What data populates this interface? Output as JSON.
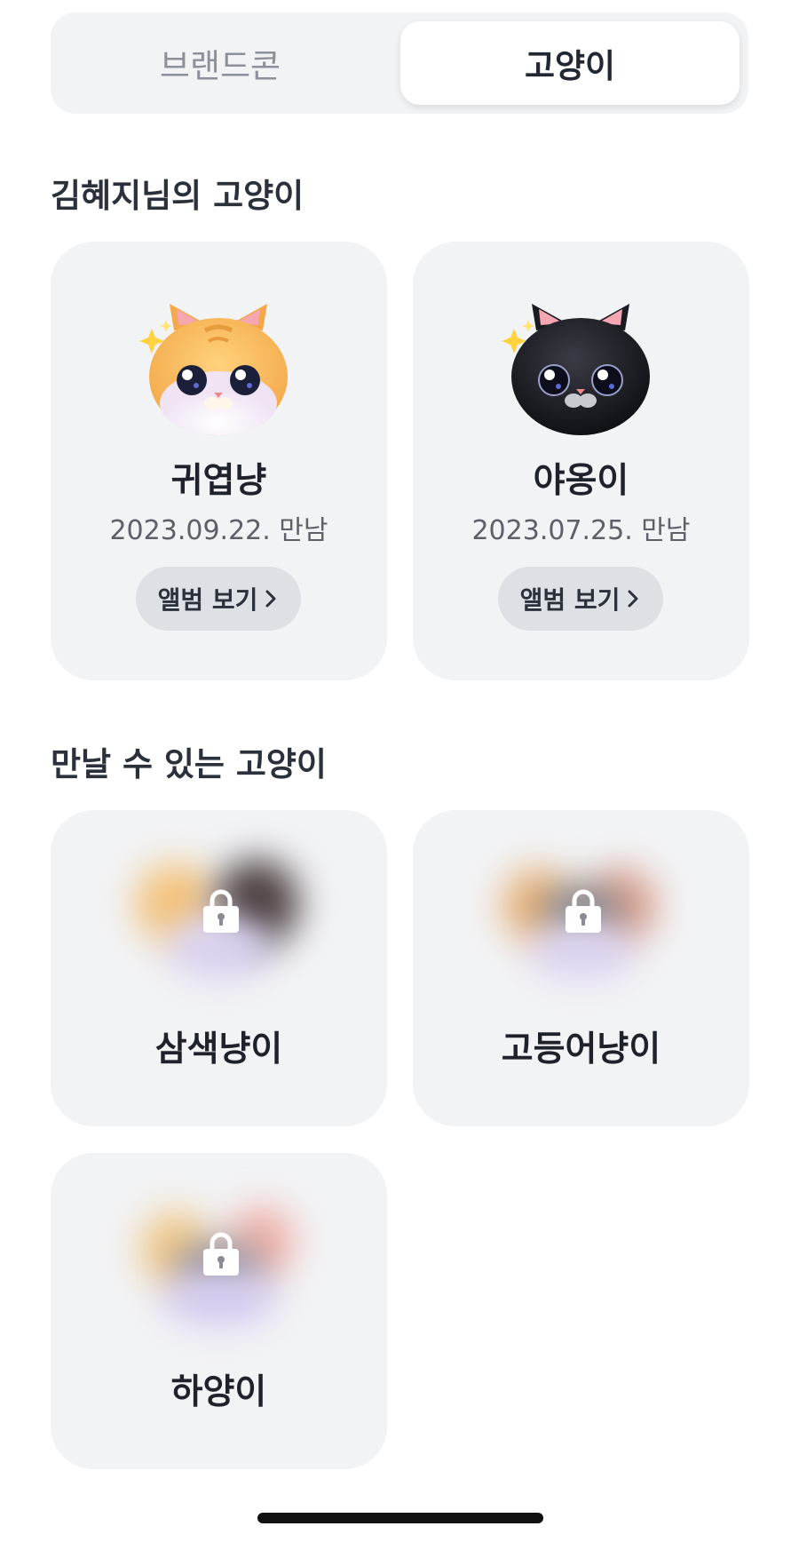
{
  "segment": {
    "tabs": [
      {
        "label": "브랜드콘",
        "active": false
      },
      {
        "label": "고양이",
        "active": true
      }
    ]
  },
  "my_cats": {
    "title": "김혜지님의 고양이",
    "cats": [
      {
        "name": "귀엽냥",
        "date": "2023.09.22. 만남",
        "button": "앨범 보기",
        "icon": "orange-tabby-cat-face"
      },
      {
        "name": "야옹이",
        "date": "2023.07.25. 만남",
        "button": "앨범 보기",
        "icon": "black-cat-face"
      }
    ]
  },
  "available_cats": {
    "title": "만날 수 있는 고양이",
    "cats": [
      {
        "name": "삼색냥이",
        "locked": true,
        "icon": "lock-icon"
      },
      {
        "name": "고등어냥이",
        "locked": true,
        "icon": "lock-icon"
      },
      {
        "name": "하양이",
        "locked": true,
        "icon": "lock-icon"
      }
    ]
  },
  "colors": {
    "card_bg": "#f2f3f5",
    "button_bg": "#dde1e6",
    "text_primary": "#222831",
    "text_muted": "#8b919a"
  }
}
